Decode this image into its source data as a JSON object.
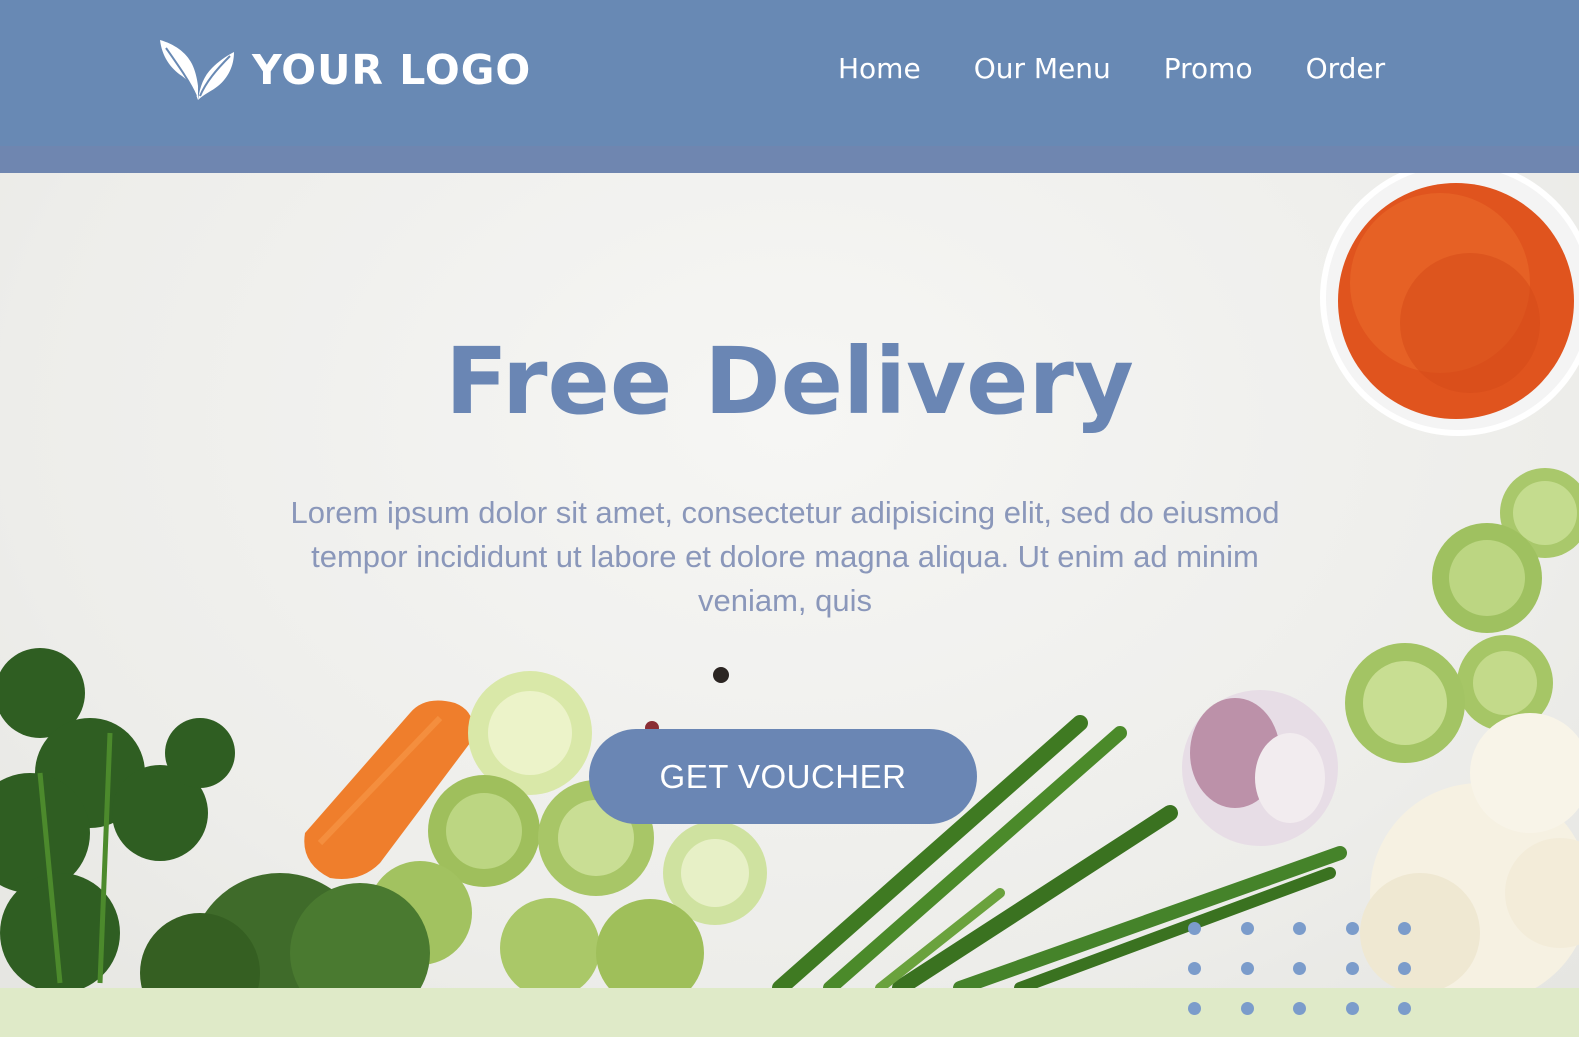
{
  "header": {
    "logo_text": "YOUR LOGO",
    "nav": [
      "Home",
      "Our Menu",
      "Promo",
      "Order"
    ]
  },
  "hero": {
    "title": "Free Delivery",
    "description": "Lorem ipsum dolor sit amet, consectetur adipisicing elit, sed do eiusmod tempor incididunt ut labore et dolore magna aliqua. Ut enim ad minim veniam, quis",
    "cta_label": "GET VOUCHER"
  },
  "colors": {
    "header_bg": "#6889b4",
    "accent": "#6a86b4",
    "footer_bar": "#dfeac8",
    "text_muted": "#8a97ba"
  },
  "icons": {
    "logo": "leaf-icon"
  }
}
